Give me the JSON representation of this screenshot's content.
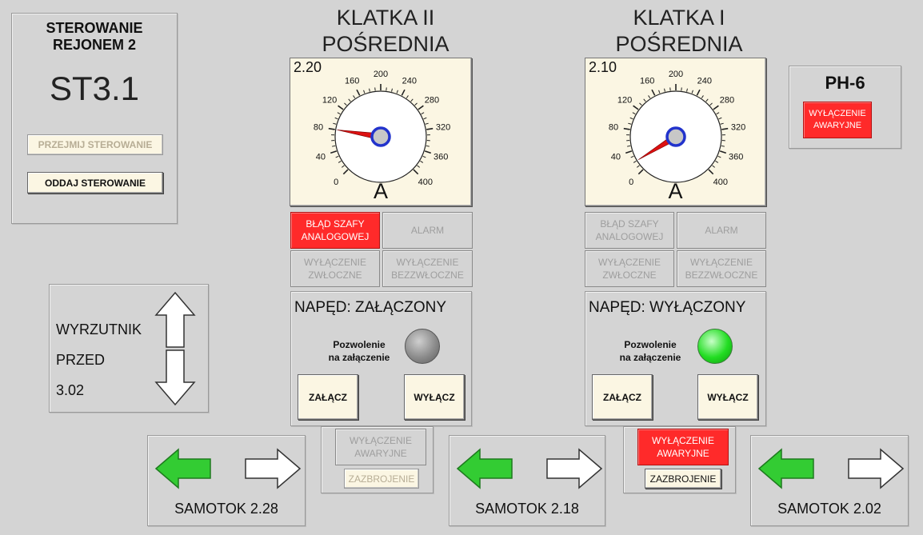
{
  "control": {
    "title": "STEROWANIE\nREJONEM 2",
    "station": "ST3.1",
    "take_btn": "PRZEJMIJ STEROWANIE",
    "give_btn": "ODDAJ STEROWANIE"
  },
  "ph6": {
    "title": "PH-6",
    "emergency": "WYŁĄCZENIE\nAWARYJNE"
  },
  "ejector": {
    "line1": "WYRZUTNIK",
    "line2": "PRZED",
    "line3": "3.02"
  },
  "cage2": {
    "title": "KLATKA II\nPOŚREDNIA",
    "gauge": {
      "id": "2.20",
      "unit": "A",
      "value": 80,
      "ticks": [
        "0",
        "40",
        "80",
        "120",
        "160",
        "200",
        "240",
        "280",
        "320",
        "360",
        "400"
      ]
    },
    "alarm_cabinet": "BŁĄD SZAFY\nANALOGOWEJ",
    "alarm": "ALARM",
    "delayed_off": "WYŁĄCZENIE\nZWŁOCZNE",
    "immediate_off": "WYŁĄCZENIE\nBEZZWŁOCZNE",
    "drive_status": "NAPĘD: ZAŁĄCZONY",
    "permission": "Pozwolenie\nna załączenie",
    "permission_lamp": "gray",
    "on_btn": "ZAŁĄCZ",
    "off_btn": "WYŁĄCZ",
    "emergency": "WYŁĄCZENIE\nAWARYJNE",
    "arm": "ZAZBROJENIE"
  },
  "cage1": {
    "title": "KLATKA I\nPOŚREDNIA",
    "gauge": {
      "id": "2.10",
      "unit": "A",
      "value": 20,
      "ticks": [
        "0",
        "40",
        "80",
        "120",
        "160",
        "200",
        "240",
        "280",
        "320",
        "360",
        "400"
      ]
    },
    "alarm_cabinet": "BŁĄD SZAFY\nANALOGOWEJ",
    "alarm": "ALARM",
    "delayed_off": "WYŁĄCZENIE\nZWŁOCZNE",
    "immediate_off": "WYŁĄCZENIE\nBEZZWŁOCZNE",
    "drive_status": "NAPĘD: WYŁĄCZONY",
    "permission": "Pozwolenie\nna załączenie",
    "permission_lamp": "green",
    "on_btn": "ZAŁĄCZ",
    "off_btn": "WYŁĄCZ",
    "emergency": "WYŁĄCZENIE\nAWARYJNE",
    "arm": "ZAZBROJENIE"
  },
  "samotoks": [
    {
      "label": "SAMOTOK 2.28"
    },
    {
      "label": "SAMOTOK 2.18"
    },
    {
      "label": "SAMOTOK 2.02"
    }
  ],
  "colors": {
    "alarm_red": "#ff2a2a",
    "arrow_green": "#33cc33",
    "lamp_green": "#22dd22",
    "lamp_gray": "#8c8c8c",
    "needle_red": "#dd1111",
    "hub_blue": "#2233cc"
  }
}
